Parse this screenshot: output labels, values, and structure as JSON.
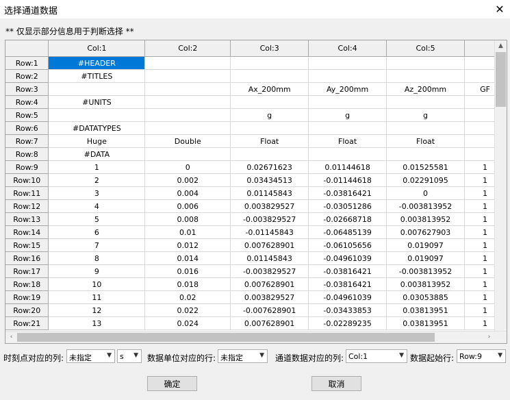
{
  "window": {
    "title": "选择通道数据",
    "close_glyph": "✕"
  },
  "note": "** 仅显示部分信息用于判断选择 **",
  "grid": {
    "columns": [
      "Col:1",
      "Col:2",
      "Col:3",
      "Col:4",
      "Col:5",
      ""
    ],
    "rows": [
      {
        "header": "Row:1",
        "cells": [
          "#HEADER",
          "",
          "",
          "",
          "",
          ""
        ]
      },
      {
        "header": "Row:2",
        "cells": [
          "#TITLES",
          "",
          "",
          "",
          "",
          ""
        ]
      },
      {
        "header": "Row:3",
        "cells": [
          "",
          "",
          "Ax_200mm",
          "Ay_200mm",
          "Az_200mm",
          "GF"
        ]
      },
      {
        "header": "Row:4",
        "cells": [
          "#UNITS",
          "",
          "",
          "",
          "",
          ""
        ]
      },
      {
        "header": "Row:5",
        "cells": [
          "",
          "",
          "g",
          "g",
          "g",
          ""
        ]
      },
      {
        "header": "Row:6",
        "cells": [
          "#DATATYPES",
          "",
          "",
          "",
          "",
          ""
        ]
      },
      {
        "header": "Row:7",
        "cells": [
          "Huge",
          "Double",
          "Float",
          "Float",
          "Float",
          ""
        ]
      },
      {
        "header": "Row:8",
        "cells": [
          "#DATA",
          "",
          "",
          "",
          "",
          ""
        ]
      },
      {
        "header": "Row:9",
        "cells": [
          "1",
          "0",
          "0.02671623",
          "0.01144618",
          "0.01525581",
          "1"
        ]
      },
      {
        "header": "Row:10",
        "cells": [
          "2",
          "0.002",
          "0.03434513",
          "-0.01144618",
          "0.02291095",
          "1"
        ]
      },
      {
        "header": "Row:11",
        "cells": [
          "3",
          "0.004",
          "0.01145843",
          "-0.03816421",
          "0",
          "1"
        ]
      },
      {
        "header": "Row:12",
        "cells": [
          "4",
          "0.006",
          "0.003829527",
          "-0.03051286",
          "-0.003813952",
          "1"
        ]
      },
      {
        "header": "Row:13",
        "cells": [
          "5",
          "0.008",
          "-0.003829527",
          "-0.02668718",
          "0.003813952",
          "1"
        ]
      },
      {
        "header": "Row:14",
        "cells": [
          "6",
          "0.01",
          "-0.01145843",
          "-0.06485139",
          "0.007627903",
          "1"
        ]
      },
      {
        "header": "Row:15",
        "cells": [
          "7",
          "0.012",
          "0.007628901",
          "-0.06105656",
          "0.019097",
          "1"
        ]
      },
      {
        "header": "Row:16",
        "cells": [
          "8",
          "0.014",
          "0.01145843",
          "-0.04961039",
          "0.019097",
          "1"
        ]
      },
      {
        "header": "Row:17",
        "cells": [
          "9",
          "0.016",
          "-0.003829527",
          "-0.03816421",
          "-0.003813952",
          "1"
        ]
      },
      {
        "header": "Row:18",
        "cells": [
          "10",
          "0.018",
          "0.007628901",
          "-0.03816421",
          "0.003813952",
          "1"
        ]
      },
      {
        "header": "Row:19",
        "cells": [
          "11",
          "0.02",
          "0.003829527",
          "-0.04961039",
          "0.03053885",
          "1"
        ]
      },
      {
        "header": "Row:20",
        "cells": [
          "12",
          "0.022",
          "-0.007628901",
          "-0.03433853",
          "0.03813951",
          "1"
        ]
      },
      {
        "header": "Row:21",
        "cells": [
          "13",
          "0.024",
          "0.007628901",
          "-0.02289235",
          "0.03813951",
          "1"
        ]
      }
    ]
  },
  "controls": {
    "time_label": "时刻点对应的列:",
    "time_value": "未指定",
    "time_unit_value": "s",
    "unit_label": "数据单位对应的行:",
    "unit_value": "未指定",
    "channel_label": "通道数据对应的列:",
    "channel_value": "Col:1",
    "start_label": "数据起始行:",
    "start_value": "Row:9"
  },
  "buttons": {
    "ok": "确定",
    "cancel": "取消"
  },
  "icons": {
    "dropdown": "chevron-down-icon",
    "scroll_up": "▲",
    "scroll_left": "‹",
    "scroll_right": "›"
  }
}
